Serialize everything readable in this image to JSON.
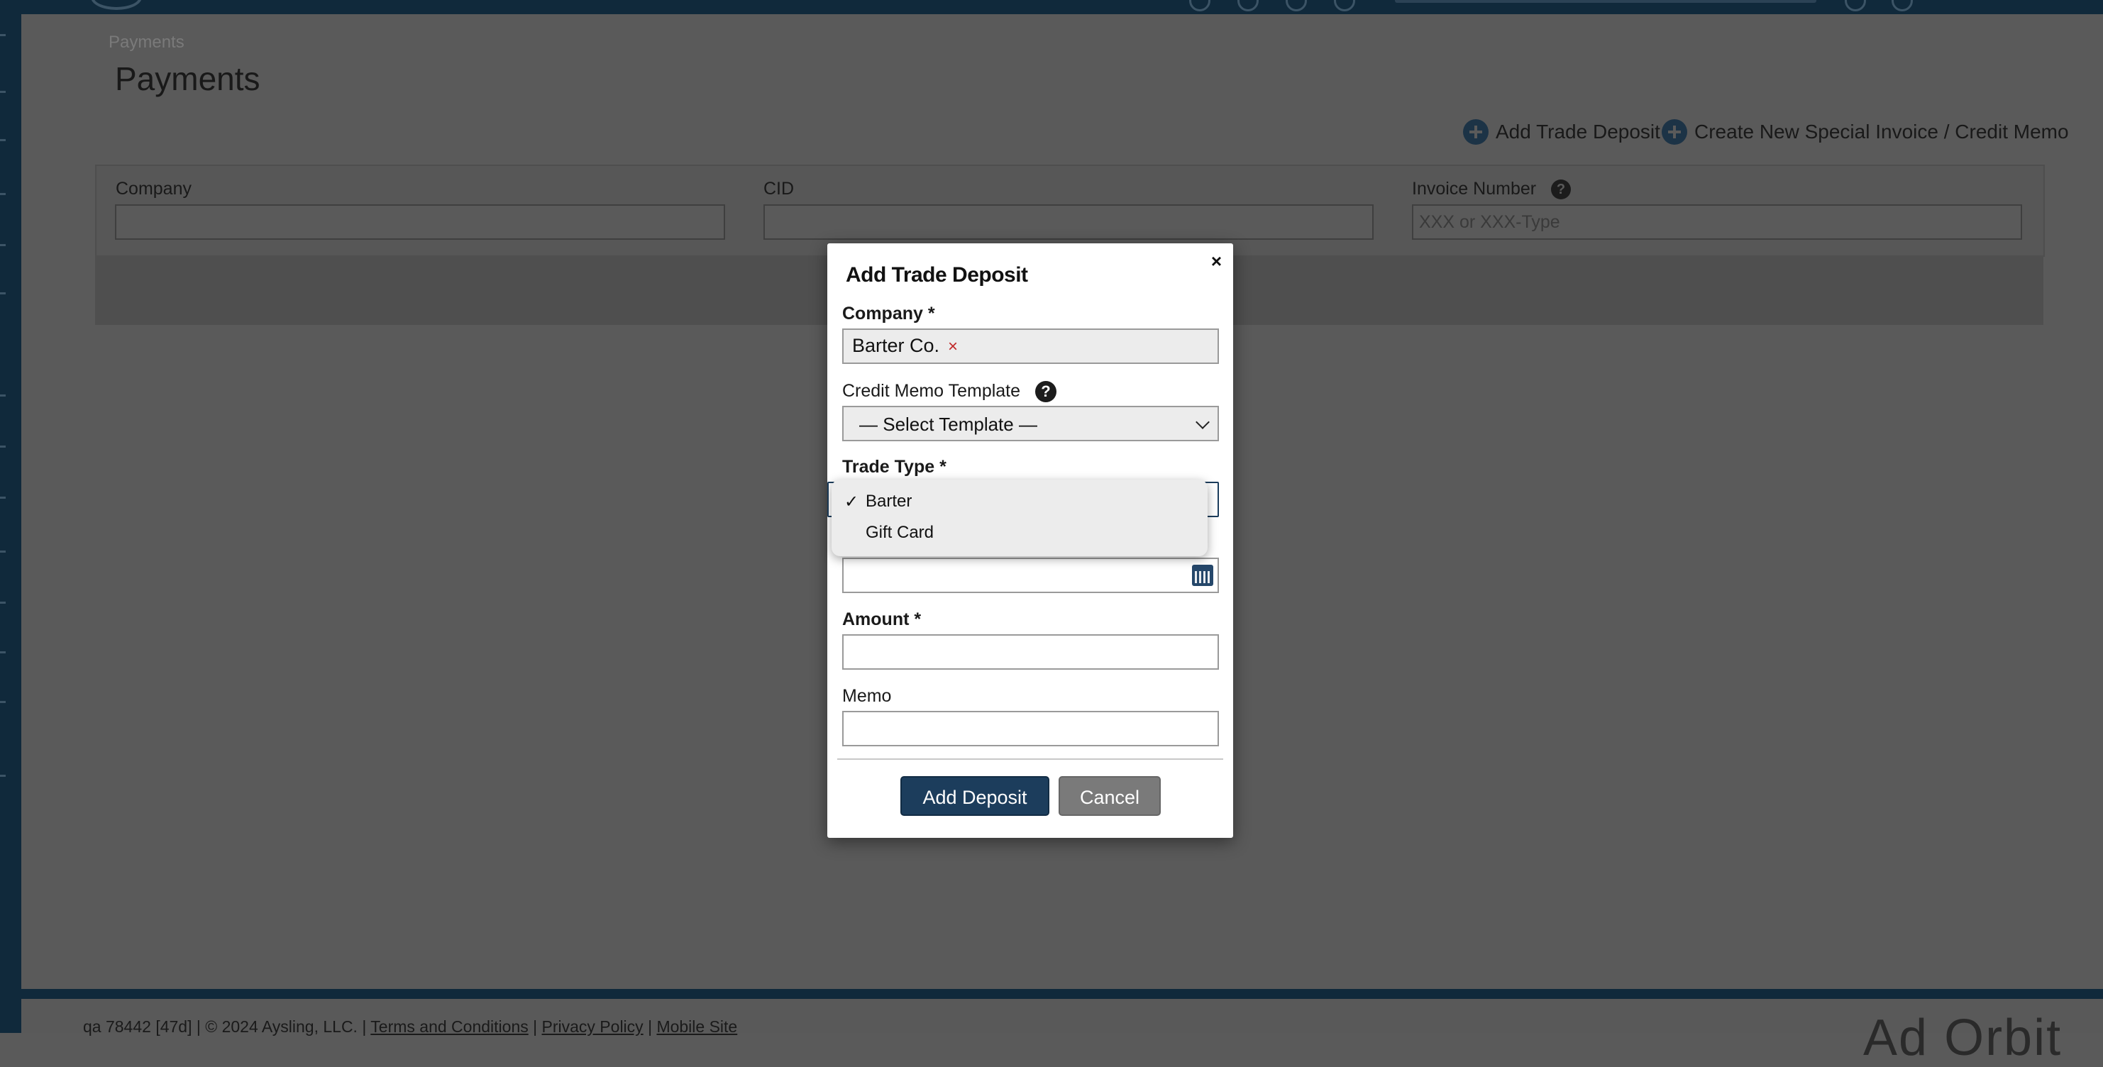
{
  "breadcrumb": "Payments",
  "page_title": "Payments",
  "actions": {
    "add_trade_deposit": "Add Trade Deposit",
    "create_special_invoice": "Create New Special Invoice / Credit Memo"
  },
  "filters": {
    "company_label": "Company",
    "company_value": "",
    "cid_label": "CID",
    "cid_value": "",
    "invoice_label": "Invoice Number",
    "invoice_placeholder": "XXX or XXX-Type"
  },
  "modal": {
    "title": "Add Trade Deposit",
    "close": "×",
    "company_label": "Company *",
    "company_value": "Barter Co.",
    "company_remove": "×",
    "template_label": "Credit Memo Template",
    "template_value": "— Select Template —",
    "trade_type_label": "Trade Type *",
    "amount_label": "Amount *",
    "memo_label": "Memo",
    "add_button": "Add Deposit",
    "cancel_button": "Cancel"
  },
  "trade_type_dropdown": {
    "options": [
      "Barter",
      "Gift Card"
    ],
    "selected": "Barter",
    "check": "✓"
  },
  "footer": {
    "prefix": "qa 78442 [47d] | © 2024 Aysling, LLC. |",
    "terms": "Terms and Conditions",
    "sep1": "|",
    "privacy": "Privacy Policy",
    "sep2": "|",
    "mobile": "Mobile Site",
    "brand": "Ad Orbit"
  },
  "colors": {
    "primary": "#1c3d5c",
    "topbar": "#10293b",
    "overlay": "#5a5a5a",
    "remove": "#c12828"
  }
}
